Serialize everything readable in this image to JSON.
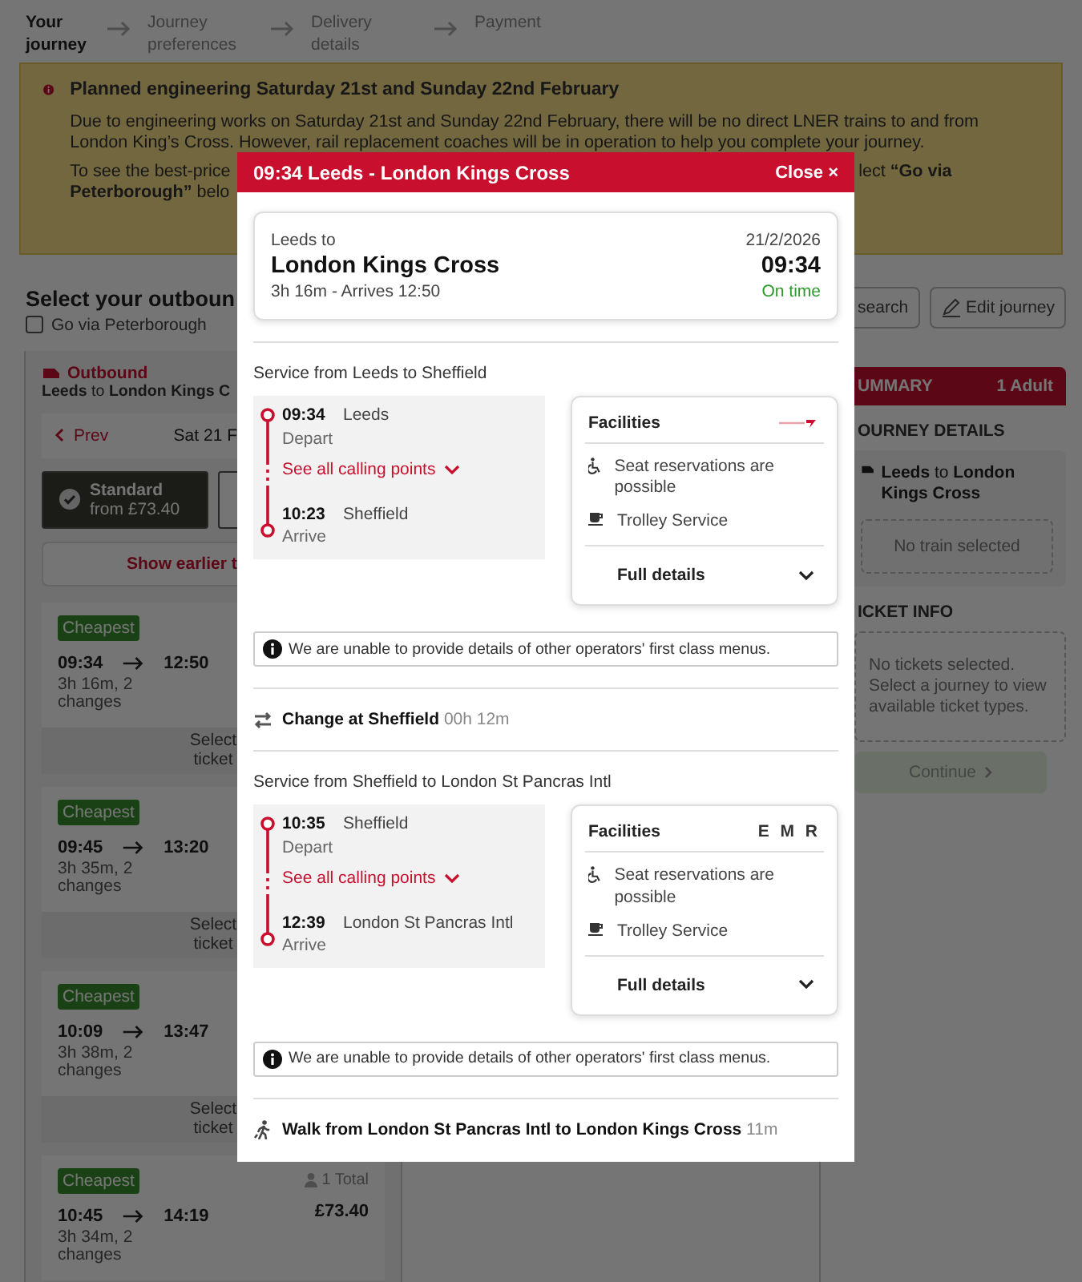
{
  "steps": [
    {
      "label": "Your journey",
      "selected": true
    },
    {
      "label": "Journey preferences",
      "selected": false
    },
    {
      "label": "Delivery details",
      "selected": false
    },
    {
      "label": "Payment",
      "selected": false
    }
  ],
  "notice": {
    "title": "Planned engineering Saturday 21st and Sunday 22nd February",
    "paragraph": "Due to engineering works on Saturday 21st and Sunday 22nd February, there will be no direct LNER trains to and from London King’s Cross. However, rail replacement coaches will be in operation to help you complete your journey.",
    "cut_left": "To see the best-price",
    "cut_right": "lect **“Go via**",
    "cut_next": "**Peterborough”** belo"
  },
  "heading": "Select your outboun",
  "via_option": {
    "label": "Go via Peterborough",
    "checked": false
  },
  "header_buttons": [
    {
      "kind": "plain",
      "label": "search"
    },
    {
      "kind": "edit",
      "label": "Edit journey"
    }
  ],
  "outbound": {
    "label": "Outbound",
    "route": "**Leeds** to **London Kings C**"
  },
  "date_nav": {
    "prev": "Prev",
    "date": "Sat 21 F"
  },
  "classes": [
    {
      "name": "Standard",
      "price": "from £73.40",
      "selected": true
    },
    {
      "selected": false
    }
  ],
  "show_earlier": "Show earlier t",
  "trains": [
    {
      "badge": "Cheapest",
      "depart": "09:34",
      "arrive": "12:50",
      "duration": "3h 16m, 2 changes",
      "action": "Select ticket"
    },
    {
      "badge": "Cheapest",
      "depart": "09:45",
      "arrive": "13:20",
      "duration": "3h 35m, 2 changes",
      "action": "Select ticket"
    },
    {
      "badge": "Cheapest",
      "depart": "10:09",
      "arrive": "13:47",
      "duration": "3h 38m, 2 changes",
      "action": "Select ticket"
    },
    {
      "badge": "Cheapest",
      "depart": "10:45",
      "arrive": "14:19",
      "duration": "3h 34m, 2 changes",
      "passengers": "1 Total",
      "price": "£73.40"
    }
  ],
  "summary": {
    "title": "UMMARY",
    "passengers": "1 Adult",
    "journey_heading": "OURNEY DETAILS",
    "route": "**Leeds** to **London Kings Cross**",
    "train_placeholder": "No train selected",
    "ticket_heading": "ICKET INFO",
    "ticket_placeholder": "No tickets selected. Select a journey to view available ticket types.",
    "continue": {
      "label": "Continue",
      "disabled": true
    }
  },
  "modal": {
    "title": "09:34 Leeds - London Kings Cross",
    "close": "Close ×",
    "journey": {
      "from": "Leeds to",
      "to": "London Kings Cross",
      "summary": "3h 16m - Arrives 12:50",
      "date": "21/2/2026",
      "time": "09:34",
      "status": "On time"
    },
    "segments": [
      {
        "kind": "service",
        "title": "Service from Leeds to Sheffield",
        "depart": {
          "time": "09:34",
          "station": "Leeds",
          "label": "Depart"
        },
        "calling_points": "See all calling points",
        "arrive": {
          "time": "10:23",
          "station": "Sheffield",
          "label": "Arrive"
        },
        "facilities": {
          "title": "Facilities",
          "logo": {
            "kind": "graphic"
          },
          "items": [
            {
              "kind": "seat",
              "text": "Seat reservations are possible"
            },
            {
              "kind": "trolley",
              "text": "Trolley Service"
            }
          ],
          "details": "Full details"
        },
        "note": "We are unable to provide details of other operators' first class menus."
      },
      {
        "kind": "change",
        "label": "Change at Sheffield",
        "duration": "00h 12m"
      },
      {
        "kind": "service",
        "title": "Service from Sheffield to London St Pancras Intl",
        "depart": {
          "time": "10:35",
          "station": "Sheffield",
          "label": "Depart"
        },
        "calling_points": "See all calling points",
        "arrive": {
          "time": "12:39",
          "station": "London St Pancras Intl",
          "label": "Arrive"
        },
        "facilities": {
          "title": "Facilities",
          "logo": {
            "kind": "text",
            "text": "E M R"
          },
          "items": [
            {
              "kind": "seat",
              "text": "Seat reservations are possible"
            },
            {
              "kind": "trolley",
              "text": "Trolley Service"
            }
          ],
          "details": "Full details"
        },
        "note": "We are unable to provide details of other operators' first class menus."
      },
      {
        "kind": "walk",
        "label": "Walk from London St Pancras Intl to London Kings Cross",
        "duration": "11m"
      }
    ]
  }
}
